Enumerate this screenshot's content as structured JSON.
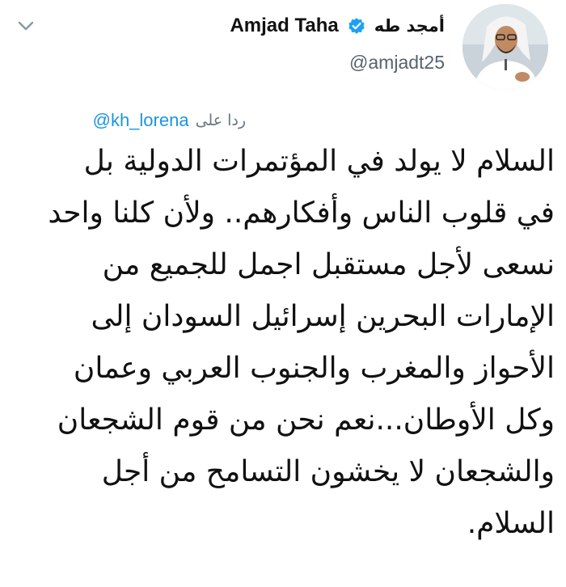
{
  "tweet": {
    "author_name_arabic": "أمجد طه",
    "author_name_latin": "Amjad Taha",
    "handle": "@amjadt25",
    "reply_prefix": "ردا على",
    "reply_mention": "@kh_lorena",
    "body_lines": [
      "السلام لا يولد في المؤتمرات الدولية بل",
      "في قلوب الناس وأفكارهم.. ولأن كلنا واحد",
      "نسعى لأجل مستقبل اجمل للجميع من",
      "الإمارات البحرين إسرائيل السودان إلى",
      "الأحواز والمغرب والجنوب العربي وعمان",
      "وكل الأوطان...نعم نحن من قوم الشجعان",
      "والشجعان لا يخشون التسامح من أجل",
      "السلام."
    ]
  },
  "icons": {
    "verified": "verified-badge-icon",
    "menu": "chevron-down-icon"
  },
  "colors": {
    "verified_blue": "#1da1f2",
    "mention_blue": "#1b95e0",
    "secondary_text": "#556370",
    "primary_text": "#111111"
  }
}
